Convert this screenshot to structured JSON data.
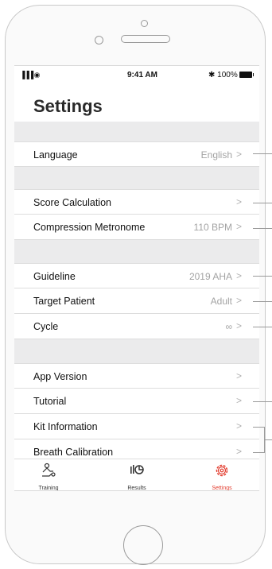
{
  "status": {
    "time": "9:41 AM",
    "battery": "✱ 100%",
    "signal": "▐▐▐ ◉"
  },
  "page_title": "Settings",
  "sections": [
    [
      {
        "label": "Language",
        "value": "English"
      }
    ],
    [
      {
        "label": "Score Calculation",
        "value": ""
      },
      {
        "label": "Compression Metronome",
        "value": "110 BPM"
      }
    ],
    [
      {
        "label": "Guideline",
        "value": "2019 AHA"
      },
      {
        "label": "Target Patient",
        "value": "Adult"
      },
      {
        "label": "Cycle",
        "value": "∞"
      }
    ],
    [
      {
        "label": "App Version",
        "value": ""
      },
      {
        "label": "Tutorial",
        "value": ""
      },
      {
        "label": "Kit Information",
        "value": ""
      },
      {
        "label": "Breath Calibration",
        "value": ""
      }
    ]
  ],
  "chevron": ">",
  "tabs": [
    {
      "label": "Training",
      "icon": "training-icon"
    },
    {
      "label": "Results",
      "icon": "results-icon"
    },
    {
      "label": "Settings",
      "icon": "settings-gear-icon",
      "active": true
    }
  ],
  "colors": {
    "accent": "#e23b2d",
    "section_band": "#ebebec",
    "value_text": "#a3a3a3"
  }
}
